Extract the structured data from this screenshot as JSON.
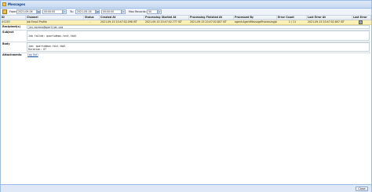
{
  "window": {
    "title": "Messages"
  },
  "toolbar": {
    "from_label": "From:",
    "from_date": "2021-09-06",
    "from_time": "00:00:00",
    "to_label": "To:",
    "to_date": "2021-09-16",
    "to_time": "00:00:00",
    "max_records_label": "Max Records:",
    "max_records": "50"
  },
  "grid": {
    "columns": [
      "ID",
      "Channel",
      "Status",
      "Created At",
      "Processing Started At",
      "Processing Finished At",
      "Processed By",
      "Error Count",
      "Last Error At",
      "Last Error"
    ],
    "row": {
      "id": "#0283",
      "channel": "Job Email Profile",
      "status": "...",
      "created_at": "2021-09-15 20:47:02.098 IST",
      "started_at": "2021-09-15 20:47:02.777 IST",
      "finished_at": "2021-09-15 20:47:02.807 IST",
      "processed_by": "agent:AgentMessageProcessingJob",
      "error_count": "1 / 11",
      "last_error_at": "2021-09-15 20:47:02.807 IST"
    }
  },
  "detail": {
    "recipients_label": "Recipient(s)",
    "recipients": "jen.moreno@bpartjob.com",
    "subject_label": "Subject",
    "subject": "Job failed: quartz#mon-test.tbbl",
    "body_label": "Body",
    "body_line1": "Job: quartz#mon-test.tbbl",
    "body_line2": "Duration: 6?",
    "attachments_label": "Attachments",
    "attachments": "Log (txt)"
  },
  "footer": {
    "close_label": "Close"
  }
}
